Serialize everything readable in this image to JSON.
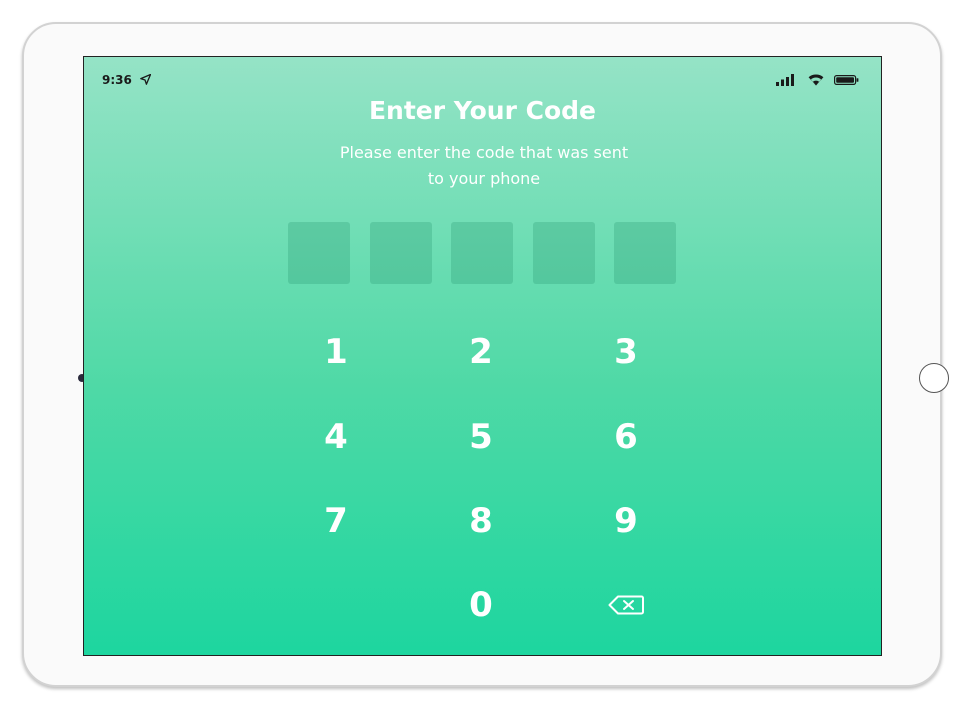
{
  "status_bar": {
    "time": "9:36",
    "location_icon": "location-arrow-icon",
    "signal_icon": "cellular-signal-icon",
    "wifi_icon": "wifi-icon",
    "battery_icon": "battery-icon"
  },
  "header": {
    "title": "Enter Your Code",
    "subtitle_line1": "Please enter the code that was sent",
    "subtitle_line2": "to your phone"
  },
  "code_input": {
    "digits": [
      "",
      "",
      "",
      "",
      ""
    ]
  },
  "keypad": {
    "keys": [
      "1",
      "2",
      "3",
      "4",
      "5",
      "6",
      "7",
      "8",
      "9",
      "0"
    ],
    "delete_icon": "backspace-icon"
  },
  "colors": {
    "gradient_top": "#95e3c6",
    "gradient_bottom": "#1dd69f",
    "text": "#ffffff",
    "code_box": "#5ec59e"
  }
}
